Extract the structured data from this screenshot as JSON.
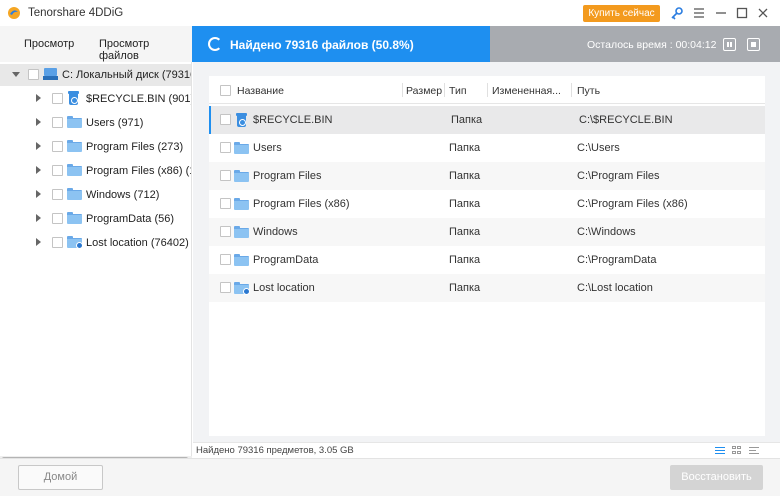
{
  "app": {
    "title": "Tenorshare 4DDiG",
    "buy_label": "Купить сейчас"
  },
  "tabs": [
    {
      "label": "Просмотр"
    },
    {
      "label": "Просмотр файлов"
    }
  ],
  "scan": {
    "found_text": "Найдено 79316 файлов (50.8%)",
    "remaining_text": "Осталось время : 00:04:12"
  },
  "tree": {
    "root_label": "C: Локальный диск  (79316",
    "items": [
      {
        "label": "$RECYCLE.BIN  (901)",
        "icon": "recycle-bin-icon"
      },
      {
        "label": "Users  (971)",
        "icon": "folder-icon"
      },
      {
        "label": "Program Files  (273)",
        "icon": "folder-icon"
      },
      {
        "label": "Program Files (x86)  (1",
        "icon": "folder-icon"
      },
      {
        "label": "Windows  (712)",
        "icon": "folder-icon"
      },
      {
        "label": "ProgramData  (56)",
        "icon": "folder-icon"
      },
      {
        "label": "Lost location  (76402)",
        "icon": "lost-folder-icon"
      }
    ]
  },
  "list": {
    "columns": [
      "Название",
      "Размер",
      "Тип",
      "Измененная...",
      "Путь"
    ],
    "rows": [
      {
        "name": "$RECYCLE.BIN",
        "type": "Папка",
        "path": "C:\\$RECYCLE.BIN",
        "icon": "recycle-bin-icon"
      },
      {
        "name": "Users",
        "type": "Папка",
        "path": "C:\\Users",
        "icon": "folder-icon"
      },
      {
        "name": "Program Files",
        "type": "Папка",
        "path": "C:\\Program Files",
        "icon": "folder-icon"
      },
      {
        "name": "Program Files (x86)",
        "type": "Папка",
        "path": "C:\\Program Files (x86)",
        "icon": "folder-icon"
      },
      {
        "name": "Windows",
        "type": "Папка",
        "path": "C:\\Windows",
        "icon": "folder-icon"
      },
      {
        "name": "ProgramData",
        "type": "Папка",
        "path": "C:\\ProgramData",
        "icon": "folder-icon"
      },
      {
        "name": "Lost location",
        "type": "Папка",
        "path": "C:\\Lost location",
        "icon": "lost-folder-icon"
      }
    ]
  },
  "status": {
    "count_text": "Найдено 79316 предметов, 3.05 GB"
  },
  "footer": {
    "home_label": "Домой",
    "restore_label": "Восстановить"
  },
  "colors": {
    "accent": "#1e8ff0",
    "buy": "#f39a1e"
  }
}
